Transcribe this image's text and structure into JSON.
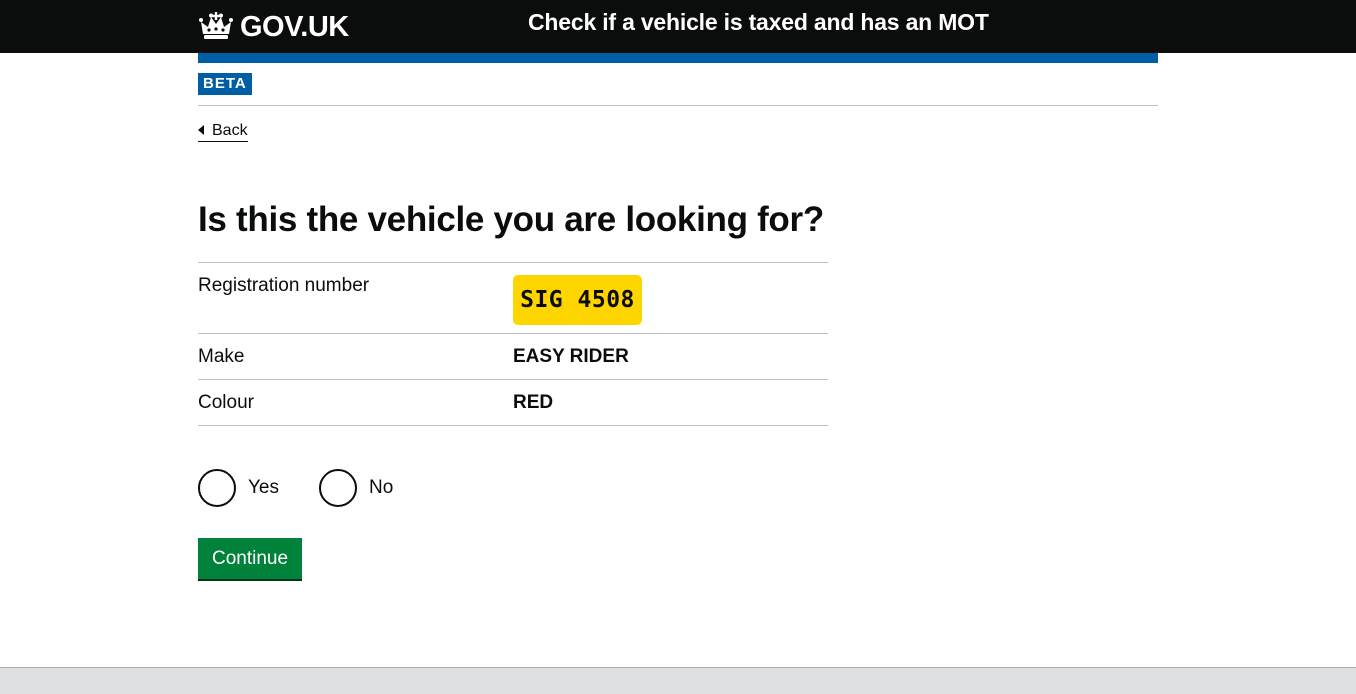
{
  "header": {
    "logo_text": "GOV.UK",
    "logo_icon": "crown-icon",
    "service_name": "Check if a vehicle is taxed and has an MOT"
  },
  "phase_banner": {
    "tag": "BETA"
  },
  "back_link": {
    "label": "Back",
    "icon": "triangle-left-icon"
  },
  "main": {
    "heading": "Is this the vehicle you are looking for?",
    "details": [
      {
        "key": "Registration number",
        "value": "SIG 4508"
      },
      {
        "key": "Make",
        "value": "EASY RIDER"
      },
      {
        "key": "Colour",
        "value": "RED"
      }
    ],
    "radios": [
      {
        "label": "Yes",
        "checked": false
      },
      {
        "label": "No",
        "checked": false
      }
    ],
    "continue_label": "Continue"
  },
  "colors": {
    "header_bg": "#0b0c0c",
    "brand_blue": "#005ea5",
    "plate_yellow": "#ffd500",
    "button_green": "#00823b",
    "footer_bg": "#dee0e2"
  }
}
